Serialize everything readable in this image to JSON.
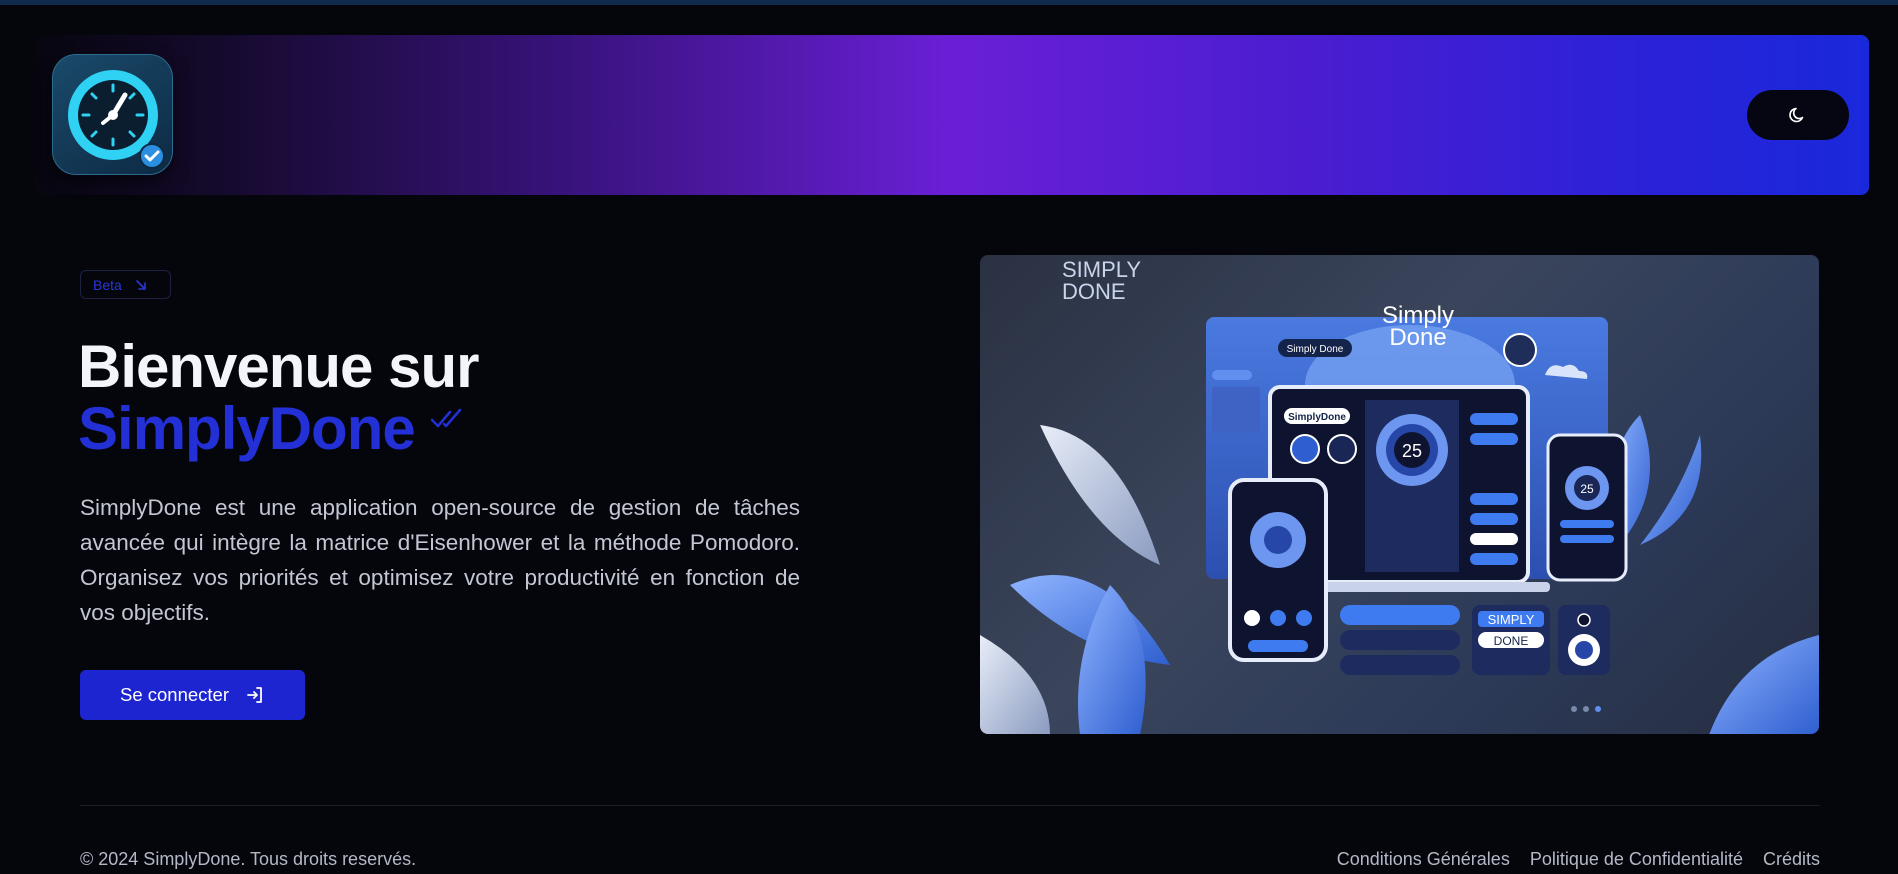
{
  "header": {
    "logo_icon": "timer-check-icon",
    "theme_toggle_icon": "moon-icon"
  },
  "hero": {
    "badge": "Beta",
    "badge_icon": "arrow-down-right-icon",
    "title_line1": "Bienvenue sur",
    "title_brand": "SimplyDone",
    "brand_icon": "double-check-icon",
    "description": "SimplyDone est une application open-source de gestion de tâches avancée qui intègre la matrice d'Eisenhower et la méthode Pomodoro. Organisez vos priorités et optimisez votre productivité en fonction de vos objectifs.",
    "login_label": "Se connecter",
    "login_icon": "login-arrow-icon"
  },
  "illustration": {
    "corner_text_1": "SIMPLY",
    "corner_text_2": "DONE",
    "center_title_1": "Simply",
    "center_title_2": "Done",
    "pill_label": "Simply Done",
    "laptop_logo": "SimplyDone",
    "timer_big": "25",
    "timer_small": "25",
    "tag_1": "SIMPLY",
    "tag_2": "DONE"
  },
  "footer": {
    "copyright": "© 2024 SimplyDone. Tous droits reservés.",
    "links": [
      "Conditions Générales",
      "Politique de Confidentialité",
      "Crédits"
    ]
  },
  "colors": {
    "background": "#05060c",
    "accent": "#1d25d0",
    "brand_text": "#2230d6",
    "header_gradient_mid": "#6a1fd6"
  }
}
